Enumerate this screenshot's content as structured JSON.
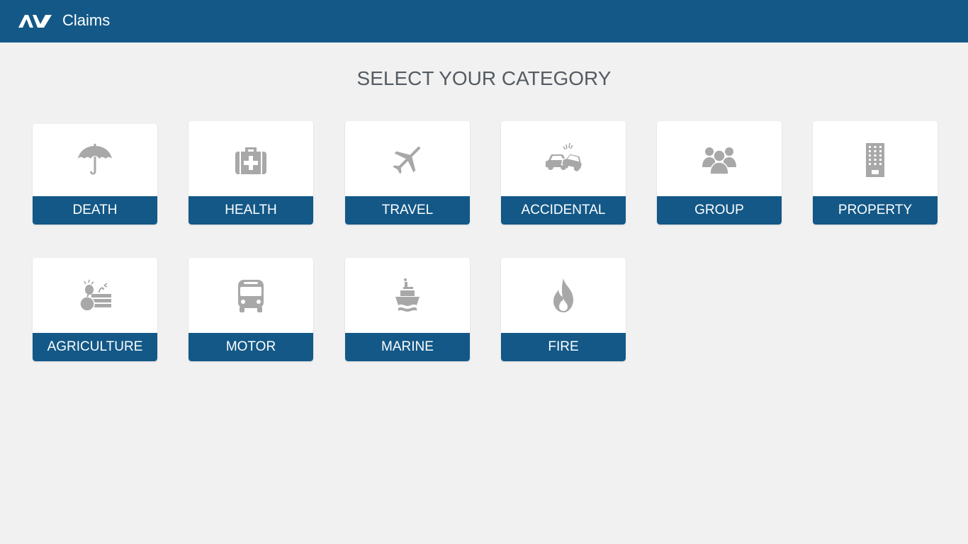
{
  "header": {
    "logo_text": "AV",
    "app_title": "Claims",
    "background_color": "#135887"
  },
  "page": {
    "heading": "SELECT YOUR CATEGORY"
  },
  "categories": [
    {
      "label": "DEATH",
      "icon": "umbrella-icon"
    },
    {
      "label": "HEALTH",
      "icon": "medical-kit-icon"
    },
    {
      "label": "TRAVEL",
      "icon": "airplane-icon"
    },
    {
      "label": "ACCIDENTAL",
      "icon": "car-crash-icon"
    },
    {
      "label": "GROUP",
      "icon": "people-group-icon"
    },
    {
      "label": "PROPERTY",
      "icon": "building-icon"
    },
    {
      "label": "AGRICULTURE",
      "icon": "agriculture-icon"
    },
    {
      "label": "MOTOR",
      "icon": "bus-icon"
    },
    {
      "label": "MARINE",
      "icon": "ship-icon"
    },
    {
      "label": "FIRE",
      "icon": "fire-icon"
    }
  ],
  "colors": {
    "accent": "#135887",
    "icon": "#a8a8a8",
    "background": "#f1f1f1"
  }
}
